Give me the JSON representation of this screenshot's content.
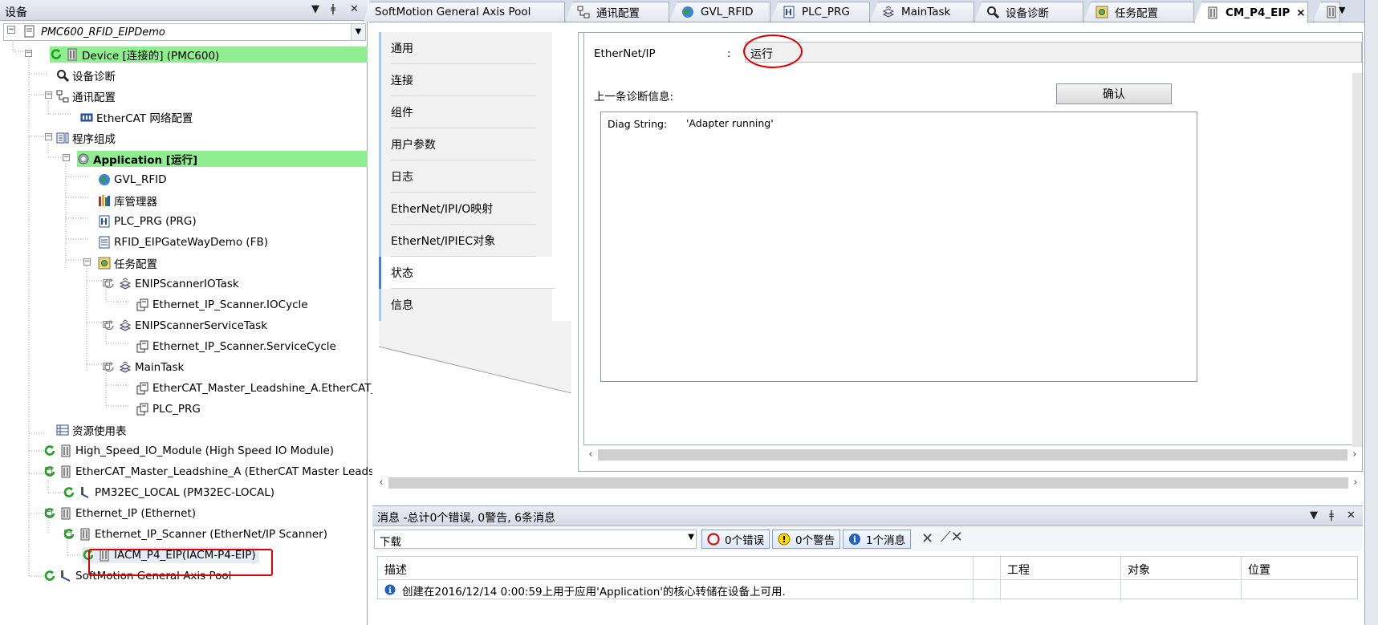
{
  "devices_panel": {
    "title": "设备",
    "project_combo": "PMC600_RFID_EIPDemo",
    "tree": [
      {
        "label": "Device [连接的] (PMC600)",
        "icon": "device-icon"
      },
      {
        "label": "设备诊断",
        "icon": "magnifier-icon"
      },
      {
        "label": "通讯配置",
        "icon": "network-icon"
      },
      {
        "label": "EtherCAT 网络配置",
        "icon": "ethercat-icon"
      },
      {
        "label": "程序组成",
        "icon": "program-icon"
      },
      {
        "label": "Application [运行]",
        "icon": "application-gear-icon"
      },
      {
        "label": "GVL_RFID",
        "icon": "globe-icon"
      },
      {
        "label": "库管理器",
        "icon": "library-icon"
      },
      {
        "label": "PLC_PRG (PRG)",
        "icon": "plc-prg-icon"
      },
      {
        "label": "RFID_EIPGateWayDemo (FB)",
        "icon": "function-block-icon"
      },
      {
        "label": "任务配置",
        "icon": "task-config-icon"
      },
      {
        "label": "ENIPScannerIOTask",
        "icon": "task-icon"
      },
      {
        "label": "Ethernet_IP_Scanner.IOCycle",
        "icon": "program-call-icon"
      },
      {
        "label": "ENIPScannerServiceTask",
        "icon": "task-icon"
      },
      {
        "label": "Ethernet_IP_Scanner.ServiceCycle",
        "icon": "program-call-icon"
      },
      {
        "label": "MainTask",
        "icon": "task-icon"
      },
      {
        "label": "EtherCAT_Master_Leadshine_A.EtherCAT_",
        "icon": "program-call-icon"
      },
      {
        "label": "PLC_PRG",
        "icon": "program-call-icon"
      },
      {
        "label": "资源使用表",
        "icon": "resource-table-icon"
      },
      {
        "label": "High_Speed_IO_Module (High Speed IO Module)",
        "icon": "module-icon"
      },
      {
        "label": "EtherCAT_Master_Leadshine_A (EtherCAT Master Leads",
        "icon": "module-icon"
      },
      {
        "label": "PM32EC_LOCAL (PM32EC-LOCAL)",
        "icon": "motor-icon"
      },
      {
        "label": "Ethernet_IP (Ethernet)",
        "icon": "module-icon"
      },
      {
        "label": "Ethernet_IP_Scanner (EtherNet/IP Scanner)",
        "icon": "module-icon"
      },
      {
        "label": "IACM_P4_EIP(IACM-P4-EIP)",
        "icon": "module-icon"
      },
      {
        "label": "SoftMotion General Axis Pool",
        "icon": "axis-pool-icon"
      }
    ]
  },
  "tabs": [
    {
      "label": "SoftMotion General Axis Pool",
      "icon": ""
    },
    {
      "label": "通讯配置",
      "icon": "network-icon"
    },
    {
      "label": "GVL_RFID",
      "icon": "globe-icon"
    },
    {
      "label": "PLC_PRG",
      "icon": "plc-prg-icon"
    },
    {
      "label": "MainTask",
      "icon": "task-icon"
    },
    {
      "label": "设备诊断",
      "icon": "magnifier-icon"
    },
    {
      "label": "任务配置",
      "icon": "task-config-icon"
    },
    {
      "label": "CM_P4_EIP",
      "icon": "module-icon",
      "active": true
    }
  ],
  "tab_close": "×",
  "side_tabs": [
    "通用",
    "连接",
    "组件",
    "用户参数",
    "日志",
    "EtherNet/IPI/O映射",
    "EtherNet/IPIEC对象",
    "状态",
    "信息"
  ],
  "status_page": {
    "ethernetip_label": "EtherNet/IP",
    "colon": ":",
    "ethernetip_value": "运行",
    "last_diag_label": "上一条诊断信息:",
    "confirm_button": "确认",
    "diag_key": "Diag String:",
    "diag_value": "'Adapter running'"
  },
  "messages": {
    "title": "消息 -总计0个错误, 0警告, 6条消息",
    "filter_value": "下载",
    "errors_button": "0个错误",
    "warnings_button": "0个警告",
    "messages_button": "1个消息",
    "columns": [
      "描述",
      "工程",
      "对象",
      "位置"
    ],
    "rows": [
      {
        "description": "创建在2016/12/14 0:00:59上用于应用'Application'的核心转储在设备上可用.",
        "project": "",
        "object": "",
        "position": ""
      }
    ]
  },
  "colors": {
    "highlight_green": "#90ee90",
    "annotation_red": "#e00000",
    "accent_blue": "#4a7fd0"
  }
}
